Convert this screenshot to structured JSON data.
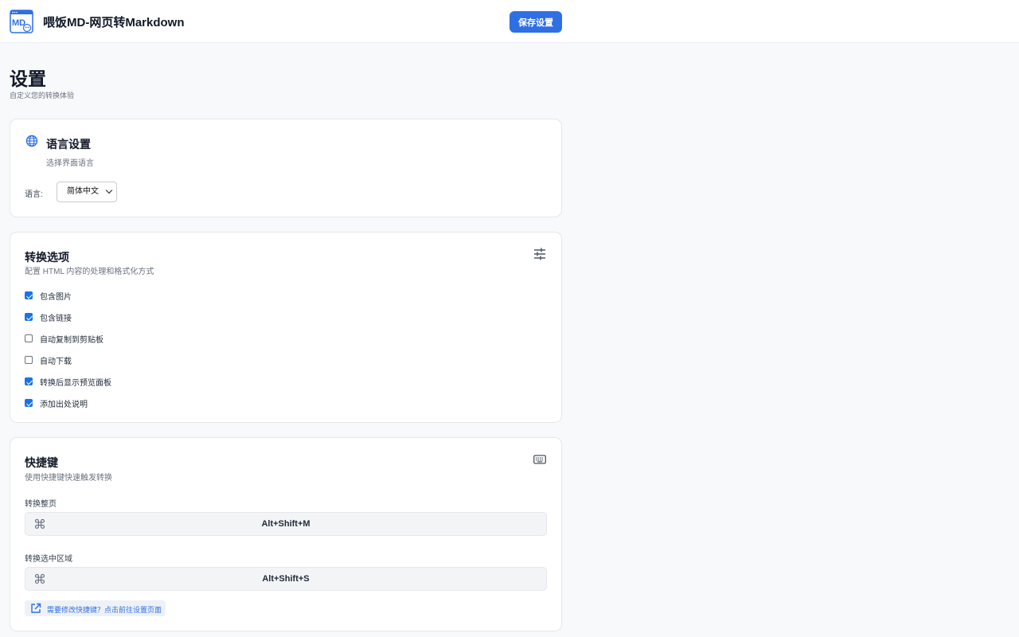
{
  "header": {
    "app_title": "喂饭MD-网页转Markdown",
    "save_label": "保存设置",
    "logo_icon": "md-logo-icon"
  },
  "page": {
    "title": "设置",
    "subtitle": "自定义您的转换体验"
  },
  "language_card": {
    "icon": "globe-icon",
    "title": "语言设置",
    "description": "选择界面语言",
    "label": "语言:",
    "selected": "简体中文"
  },
  "conversion_card": {
    "icon": "sliders-icon",
    "title": "转换选项",
    "description": "配置 HTML 内容的处理和格式化方式",
    "options": [
      {
        "label": "包含图片",
        "checked": true
      },
      {
        "label": "包含链接",
        "checked": true
      },
      {
        "label": "自动复制到剪贴板",
        "checked": false
      },
      {
        "label": "自动下载",
        "checked": false
      },
      {
        "label": "转换后显示预览面板",
        "checked": true
      },
      {
        "label": "添加出处说明",
        "checked": true
      }
    ]
  },
  "shortcuts_card": {
    "icon": "keyboard-icon",
    "title": "快捷键",
    "description": "使用快捷键快速触发转换",
    "shortcuts": [
      {
        "label": "转换整页",
        "combo": "Alt+Shift+M"
      },
      {
        "label": "转换选中区域",
        "combo": "Alt+Shift+S"
      }
    ],
    "hint_icon": "external-link-icon",
    "hint": "需要修改快捷键？点击前往设置页面"
  },
  "colors": {
    "accent": "#2f6fe4",
    "checkbox": "#1a73e8",
    "background": "#f8f9fb"
  }
}
